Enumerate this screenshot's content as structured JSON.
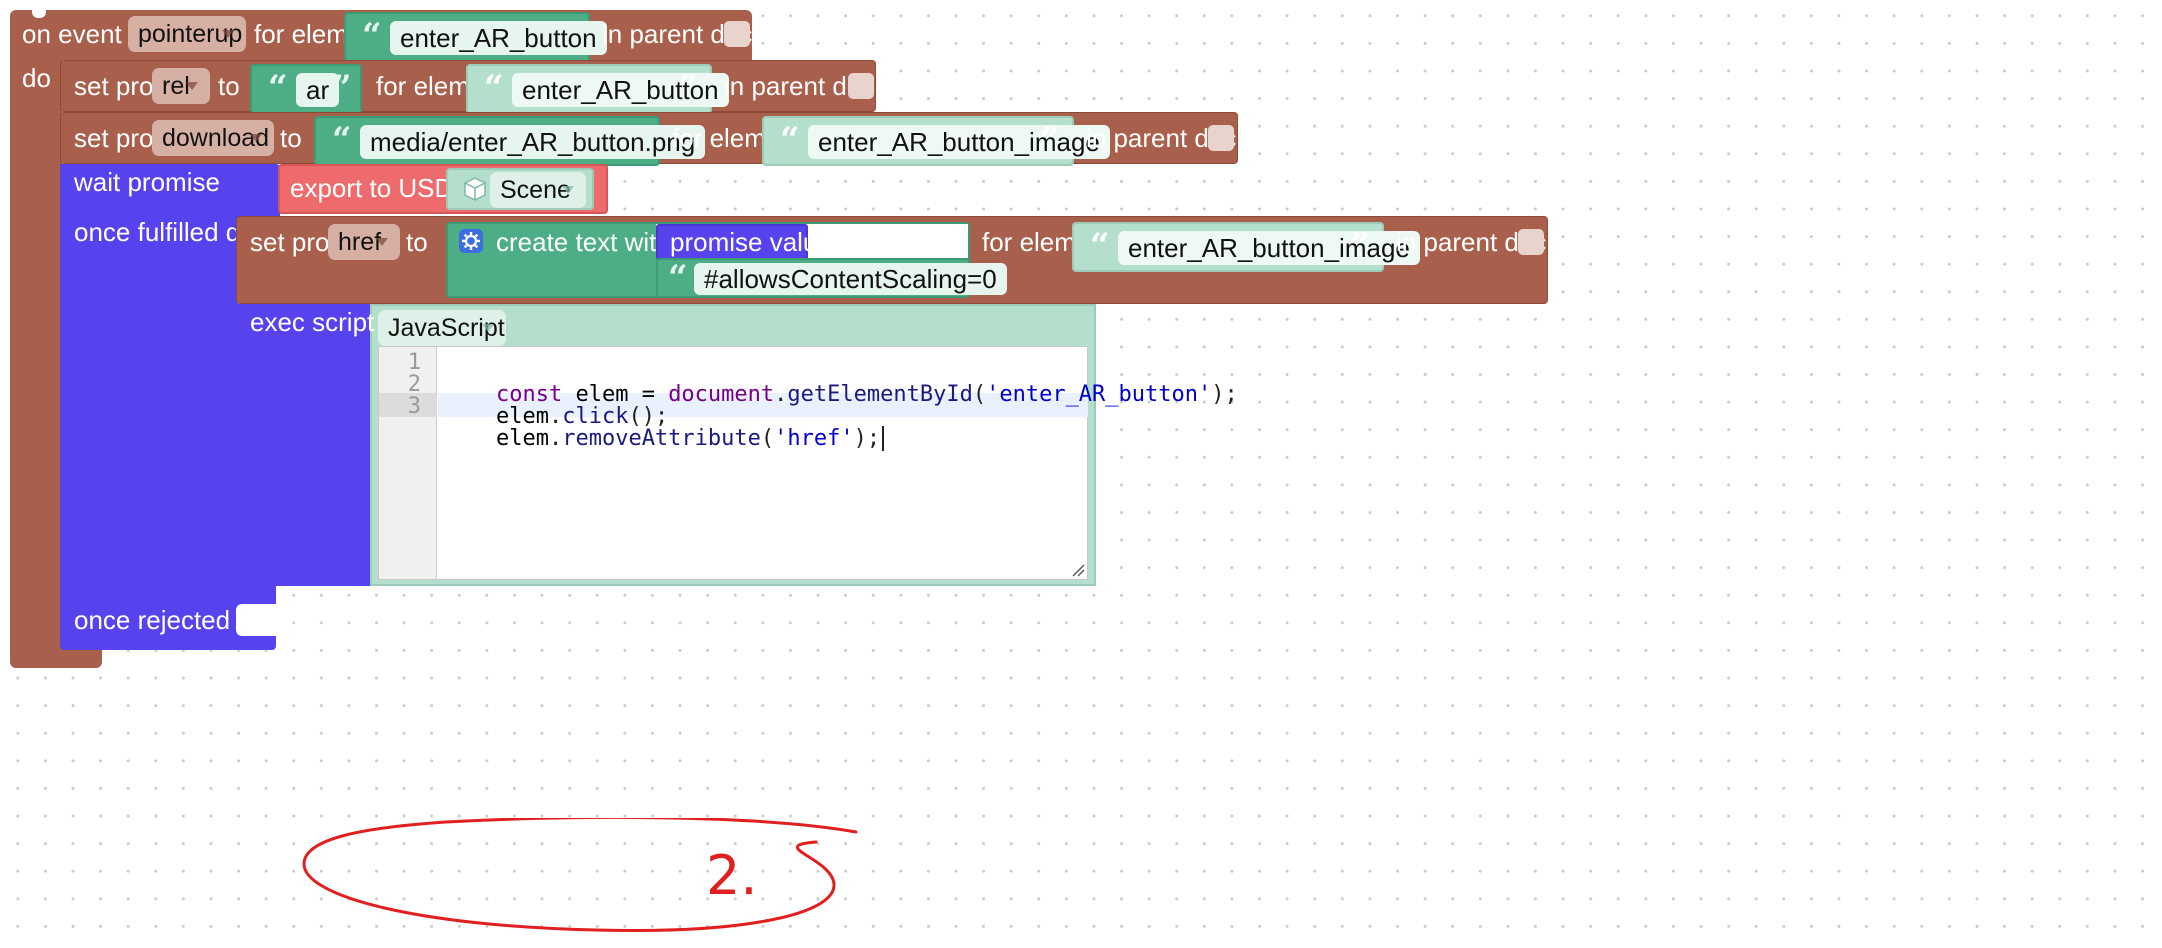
{
  "event_block": {
    "prefix": "on event of",
    "event": "pointerup",
    "for_elem": "for elem",
    "elem_id": "enter_AR_button",
    "in_parent_doc": "in parent doc",
    "do": "do"
  },
  "set_rel": {
    "label": "set prop",
    "prop": "rel",
    "to": "to",
    "value": "ar",
    "for_elem": "for elem",
    "elem_id": "enter_AR_button",
    "in_parent_doc": "in parent doc"
  },
  "set_download": {
    "label": "set prop",
    "prop": "download",
    "to": "to",
    "value": "media/enter_AR_button.png",
    "for_elem": "for elem",
    "elem_id": "enter_AR_button_image",
    "in_parent_doc": "in parent doc"
  },
  "wait_promise": {
    "label": "wait promise",
    "export_label": "export to USDZ",
    "scene": "Scene",
    "once_fulfilled": "once fulfilled do",
    "once_rejected": "once rejected do"
  },
  "set_href": {
    "label": "set prop",
    "prop": "href",
    "to": "to",
    "create_text": "create text with",
    "promise_value": "promise value",
    "suffix": "#allowsContentScaling=0",
    "for_elem": "for elem",
    "elem_id": "enter_AR_button_image",
    "in_parent_doc": "in parent doc"
  },
  "exec_script": {
    "label": "exec script",
    "language": "JavaScript",
    "line_numbers": [
      "1",
      "2",
      "3"
    ],
    "lines": [
      [
        "const",
        " elem = ",
        "document",
        ".",
        "getElementById",
        "(",
        "'enter_AR_button'",
        ");"
      ],
      [
        "elem",
        ".",
        "click",
        "();"
      ],
      [
        "elem",
        ".",
        "removeAttribute",
        "(",
        "'href'",
        ");"
      ]
    ]
  },
  "annotation": {
    "text": "2.",
    "color": "#e02020"
  },
  "colors": {
    "brown_block": "#a85f4b",
    "purple_block": "#5743ee",
    "green_block": "#4dae86",
    "light_green_block": "#b4dfcd",
    "red_block": "#ee6b6d"
  }
}
